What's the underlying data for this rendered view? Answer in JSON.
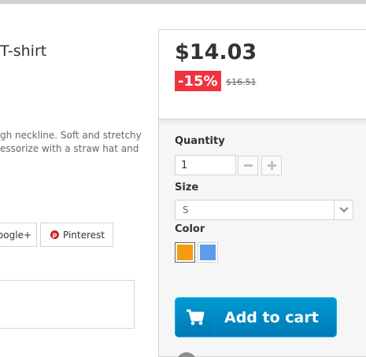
{
  "product": {
    "title_fragment": "T-shirt",
    "description_lines": [
      "gh neckline. Soft and stretchy",
      "essorize with a straw hat and"
    ]
  },
  "share": {
    "google_label": "oogle+",
    "pinterest_label": "Pinterest"
  },
  "pricing": {
    "price": "$14.03",
    "discount": "-15%",
    "old_price": "$16.51",
    "discount_color": "#f13340"
  },
  "options": {
    "quantity_label": "Quantity",
    "quantity_value": "1",
    "size_label": "Size",
    "size_value": "S",
    "color_label": "Color",
    "colors": [
      {
        "name": "orange",
        "hex": "#f39c11",
        "selected": true
      },
      {
        "name": "blue",
        "hex": "#5d9cec",
        "selected": false
      }
    ]
  },
  "cart": {
    "label": "Add to cart",
    "button_color": "#0088c6"
  },
  "icons": {
    "minus": "minus-icon",
    "plus": "plus-icon",
    "dropdown": "chevron-down-icon",
    "cart": "shopping-cart-icon",
    "pinterest": "pinterest-icon"
  }
}
